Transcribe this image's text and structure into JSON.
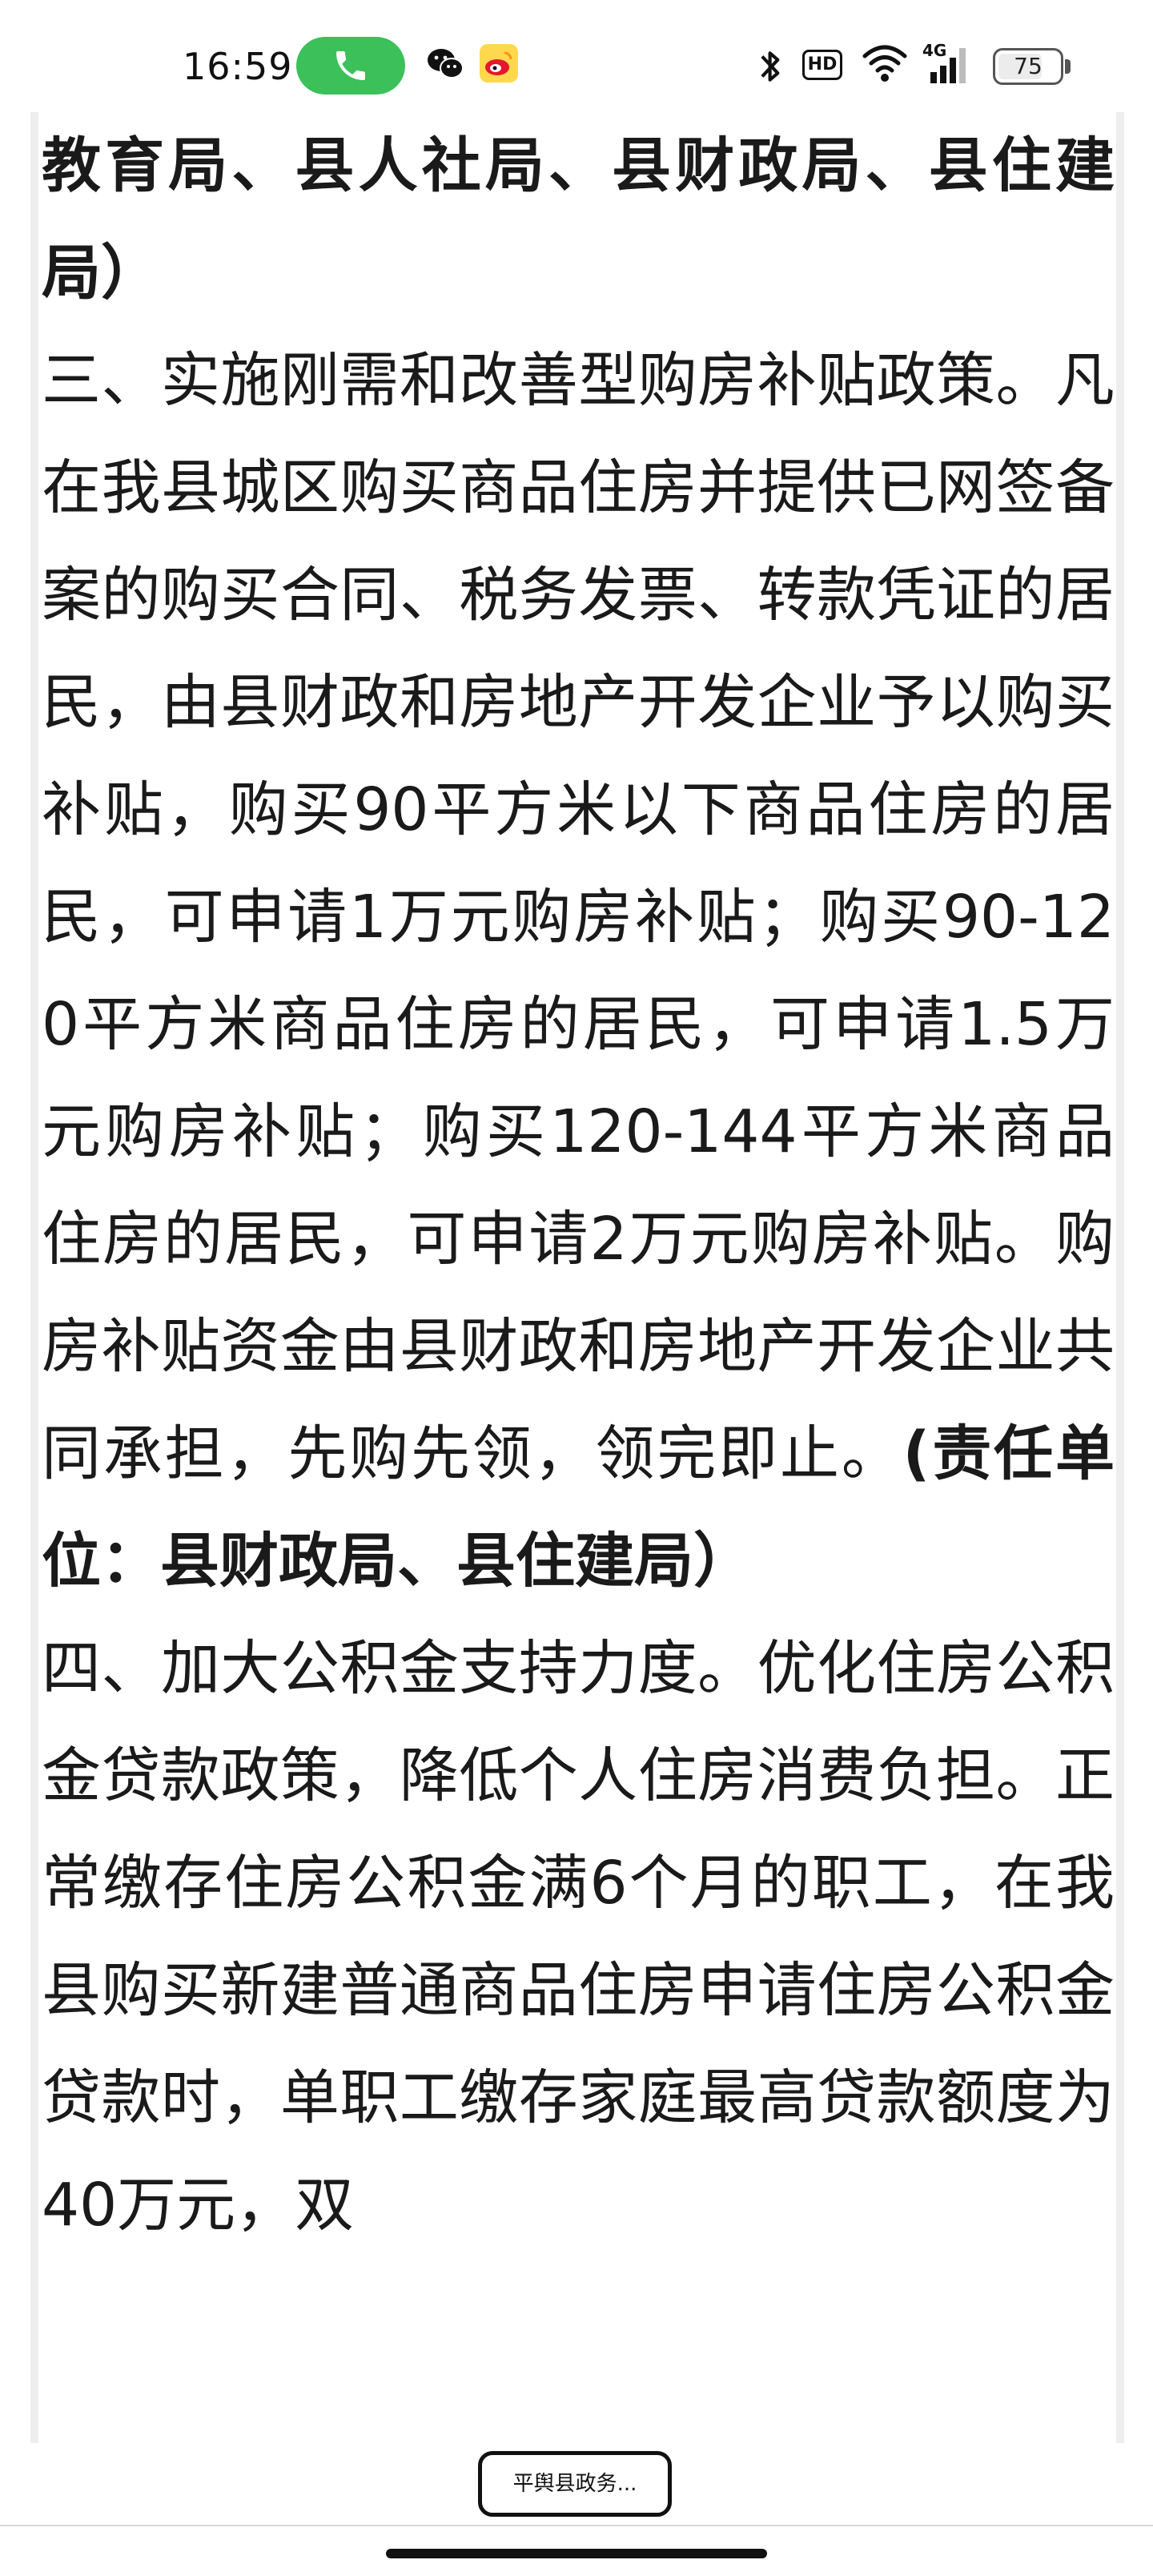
{
  "status_bar": {
    "time": "16:59",
    "network": "4G",
    "battery": "75",
    "hd": "HD"
  },
  "article": {
    "continued_line": "教育局、县人社局、县财政局、县住建局）",
    "section3_text": "三、实施刚需和改善型购房补贴政策。凡在我县城区购买商品住房并提供已网签备案的购买合同、税务发票、转款凭证的居民，由县财政和房地产开发企业予以购买补贴，购买90平方米以下商品住房的居民，可申请1万元购房补贴；购买90-120平方米商品住房的居民，可申请1.5万元购房补贴；购买120-144平方米商品住房的居民，可申请2万元购房补贴。购房补贴资金由县财政和房地产开发企业共同承担，先购先领，领完即止。",
    "section3_resp": "(责任单位：县财政局、县住建局）",
    "section4_text": "四、加大公积金支持力度。优化住房公积金贷款政策，降低个人住房消费负担。正常缴存住房公积金满6个月的职工，在我县购买新建普通商品住房申请住房公积金贷款时，单职工缴存家庭最高贷款额度为40万元，双"
  },
  "source_chip": "平舆县政务..."
}
